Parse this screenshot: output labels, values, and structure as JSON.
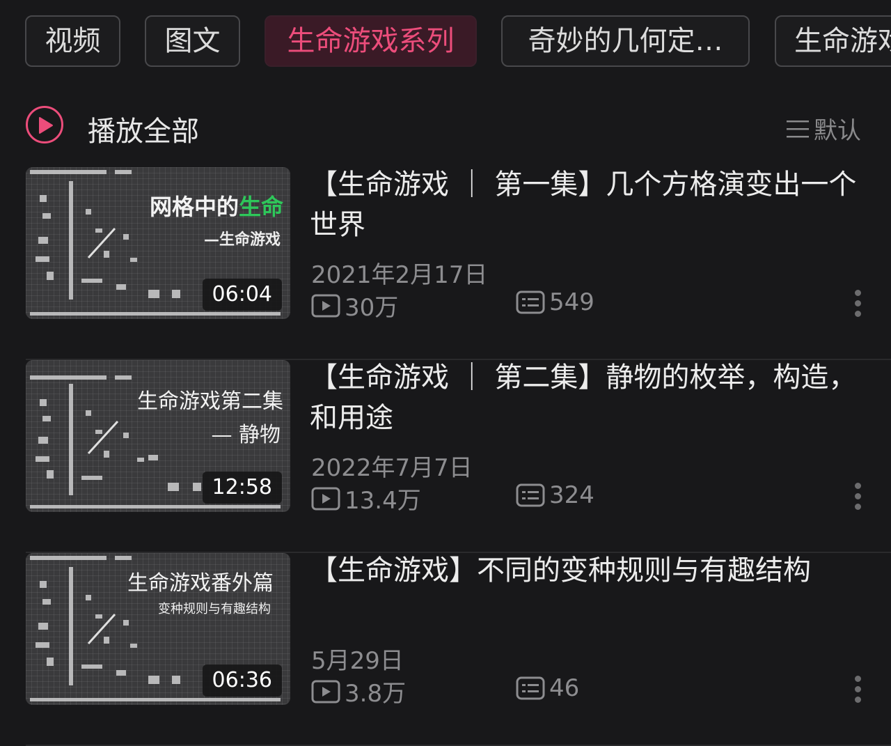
{
  "tabs": [
    {
      "label": "视频",
      "active": false
    },
    {
      "label": "图文",
      "active": false
    },
    {
      "label": "生命游戏系列",
      "active": true
    },
    {
      "label": "奇妙的几何定…",
      "active": false
    },
    {
      "label": "生命游戏",
      "active": false
    }
  ],
  "play_all": {
    "label": "播放全部",
    "sort_label": "默认"
  },
  "videos": [
    {
      "title": "【生命游戏 ｜ 第一集】几个方格演变出一个世界",
      "date": "2021年2月17日",
      "views": "30万",
      "comments": "549",
      "duration": "06:04",
      "thumb_title_main": "网格中的",
      "thumb_title_highlight": "生命",
      "thumb_subtitle": "—生命游戏"
    },
    {
      "title": "【生命游戏 ｜ 第二集】静物的枚举，构造，和用途",
      "date": "2022年7月7日",
      "views": "13.4万",
      "comments": "324",
      "duration": "12:58",
      "thumb_title_main": "生命游戏第二集",
      "thumb_title_highlight": "",
      "thumb_subtitle": "— 静物"
    },
    {
      "title": "【生命游戏】不同的变种规则与有趣结构",
      "date": "5月29日",
      "views": "3.8万",
      "comments": "46",
      "duration": "06:36",
      "thumb_title_main": "生命游戏番外篇",
      "thumb_title_highlight": "",
      "thumb_subtitle": "变种规则与有趣结构"
    }
  ],
  "colors": {
    "accent": "#ec4d7b",
    "background": "#18181a",
    "secondary_text": "#8d8d90",
    "highlight_green": "#2ec75a"
  },
  "icons": [
    "play-circle-icon",
    "sort-menu-icon",
    "play-count-icon",
    "danmaku-icon",
    "more-icon"
  ]
}
